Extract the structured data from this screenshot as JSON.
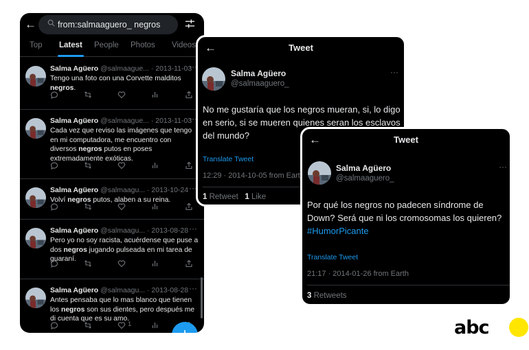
{
  "search": {
    "query": "from:salmaaguero_ negros"
  },
  "tabs": [
    {
      "label": "Top"
    },
    {
      "label": "Latest"
    },
    {
      "label": "People"
    },
    {
      "label": "Photos"
    },
    {
      "label": "Videos"
    }
  ],
  "feed": [
    {
      "name": "Salma Agüero",
      "handle": "@salmaague... · 2013-11-03",
      "parts": [
        "Tengo una foto con una Corvette malditos ",
        "negros",
        "."
      ],
      "likes": ""
    },
    {
      "name": "Salma Agüero",
      "handle": "@salmaague... · 2013-11-03",
      "parts": [
        "Cada vez que reviso las imágenes que tengo en mi computadora, me encuentro con diversos ",
        "negros",
        " putos en poses extremadamente exóticas."
      ],
      "likes": ""
    },
    {
      "name": "Salma Agüero",
      "handle": "@salmaagu... · 2013-10-24",
      "parts": [
        "Volví ",
        "negros",
        " putos, alaben a su reina."
      ],
      "likes": ""
    },
    {
      "name": "Salma Agüero",
      "handle": "@salmaagu... · 2013-08-28",
      "parts": [
        "Pero yo no soy racista, acuérdense que puse a dos ",
        "negros",
        " jugando pulseada en mi tarea de guaraní."
      ],
      "likes": ""
    },
    {
      "name": "Salma Agüero",
      "handle": "@salmaagu... · 2013-08-28",
      "parts": [
        "Antes pensaba que lo mas blanco que tienen los ",
        "negros",
        " son sus dientes, pero después me di cuenta que es su amo."
      ],
      "likes": "1"
    }
  ],
  "card1": {
    "title": "Tweet",
    "name": "Salma Agüero",
    "handle": "@salmaaguero_",
    "text": "No me gustaría que los negros mueran, si, lo digo en serio, si se mueren quienes seran los esclavos del mundo?",
    "translate": "Translate Tweet",
    "meta": "12:29 · 2014-10-05 from Earth",
    "retweets_count": "1",
    "retweets_label": "Retweet",
    "likes_count": "1",
    "likes_label": "Like"
  },
  "card2": {
    "title": "Tweet",
    "name": "Salma Agüero",
    "handle": "@salmaaguero_",
    "text": "Por qué los negros no padecen síndrome de Down? Será que ni los cromosomas los quieren? ",
    "hashtag": "#HumorPicante",
    "translate": "Translate Tweet",
    "meta": "21:17 · 2014-01-26 from Earth",
    "retweets_count": "3",
    "retweets_label": "Retweets"
  },
  "brand": {
    "logo": "abc"
  },
  "colors": {
    "accent": "#1d9bf0",
    "background": "#000000",
    "muted": "#71767b",
    "logo_dot": "#ffe600"
  },
  "icons": [
    "back-arrow-icon",
    "search-icon",
    "filter-icon",
    "more-icon",
    "reply-icon",
    "retweet-icon",
    "like-icon",
    "views-icon",
    "share-icon",
    "compose-icon"
  ]
}
